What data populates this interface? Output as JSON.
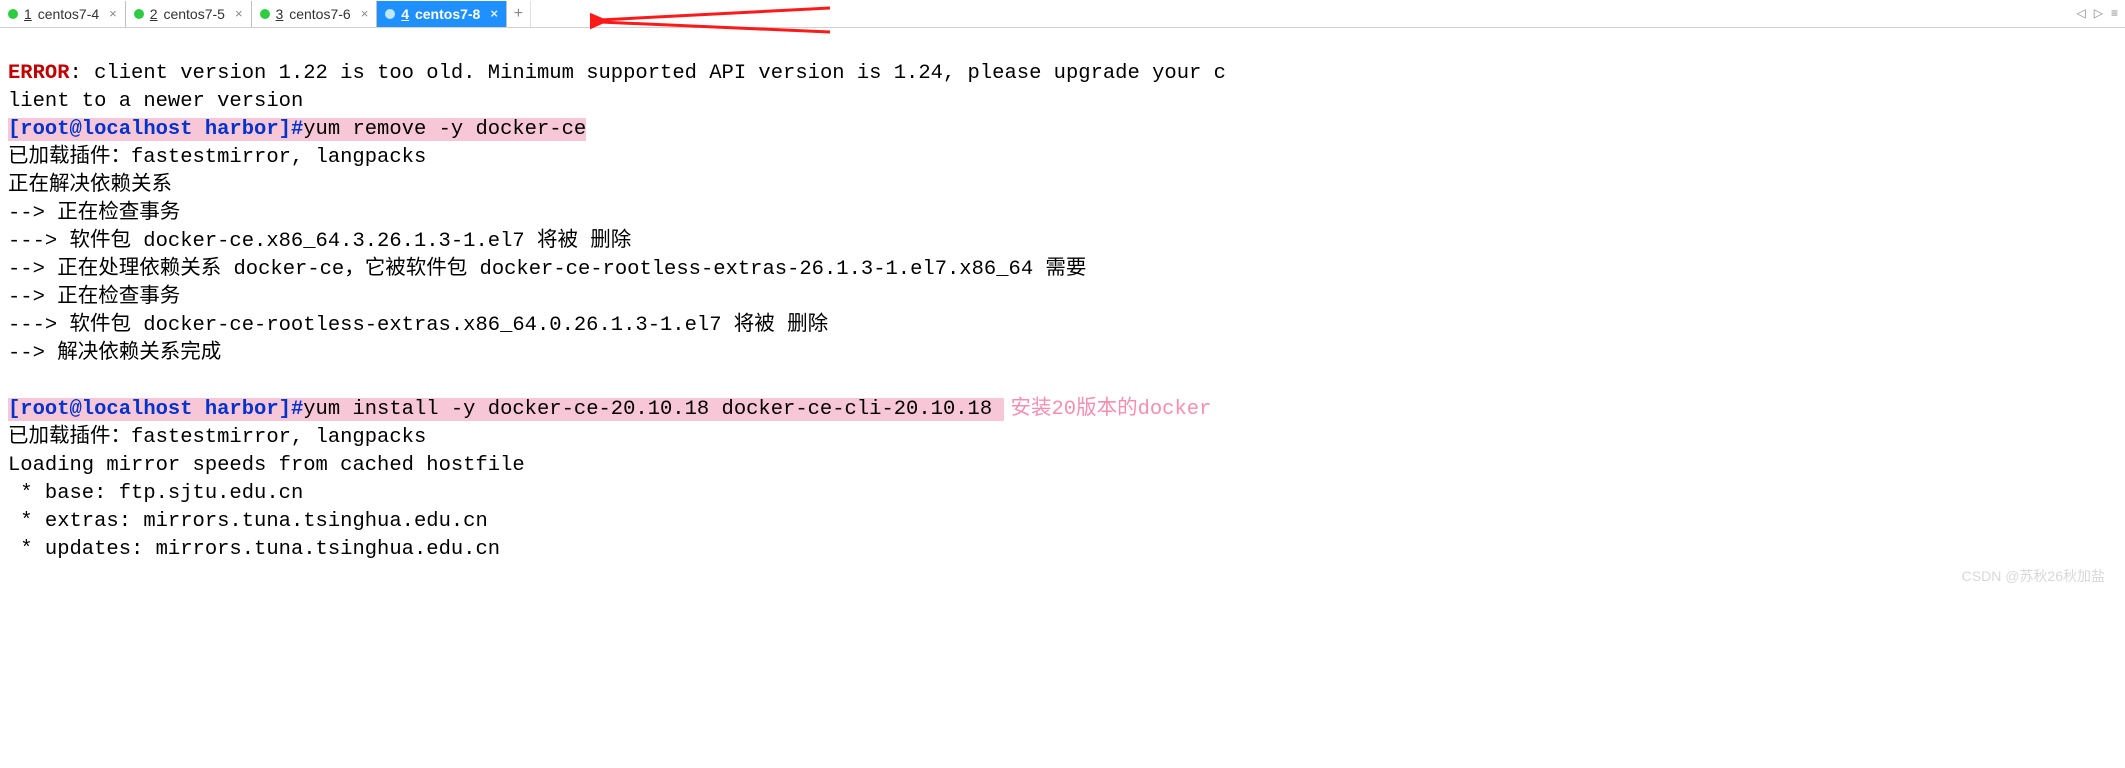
{
  "tabs": [
    {
      "num": "1",
      "label": "centos7-4"
    },
    {
      "num": "2",
      "label": "centos7-5"
    },
    {
      "num": "3",
      "label": "centos7-6"
    },
    {
      "num": "4",
      "label": "centos7-8"
    }
  ],
  "controls": {
    "close": "×",
    "add": "+",
    "left": "◁",
    "right": "▷",
    "menu": "≡"
  },
  "terminal": {
    "error_label": "ERROR",
    "error_msg": ": client version 1.22 is too old. Minimum supported API version is 1.24, please upgrade your c\nlient to a newer version",
    "prompt1_user": "[root@localhost harbor]#",
    "cmd1": "yum remove -y docker-ce",
    "block1": "已加载插件：fastestmirror, langpacks\n正在解决依赖关系\n--> 正在检查事务\n---> 软件包 docker-ce.x86_64.3.26.1.3-1.el7 将被 删除\n--> 正在处理依赖关系 docker-ce，它被软件包 docker-ce-rootless-extras-26.1.3-1.el7.x86_64 需要\n--> 正在检查事务\n---> 软件包 docker-ce-rootless-extras.x86_64.0.26.1.3-1.el7 将被 删除\n--> 解决依赖关系完成\n",
    "prompt2_user": "[root@localhost harbor]#",
    "cmd2": "yum install -y docker-ce-20.10.18 docker-ce-cli-20.10.18 ",
    "annotation": "安装20版本的docker",
    "block2": "已加载插件：fastestmirror, langpacks\nLoading mirror speeds from cached hostfile\n * base: ftp.sjtu.edu.cn\n * extras: mirrors.tuna.tsinghua.edu.cn\n * updates: mirrors.tuna.tsinghua.edu.cn"
  },
  "watermark": "CSDN @苏秋26秋加盐"
}
